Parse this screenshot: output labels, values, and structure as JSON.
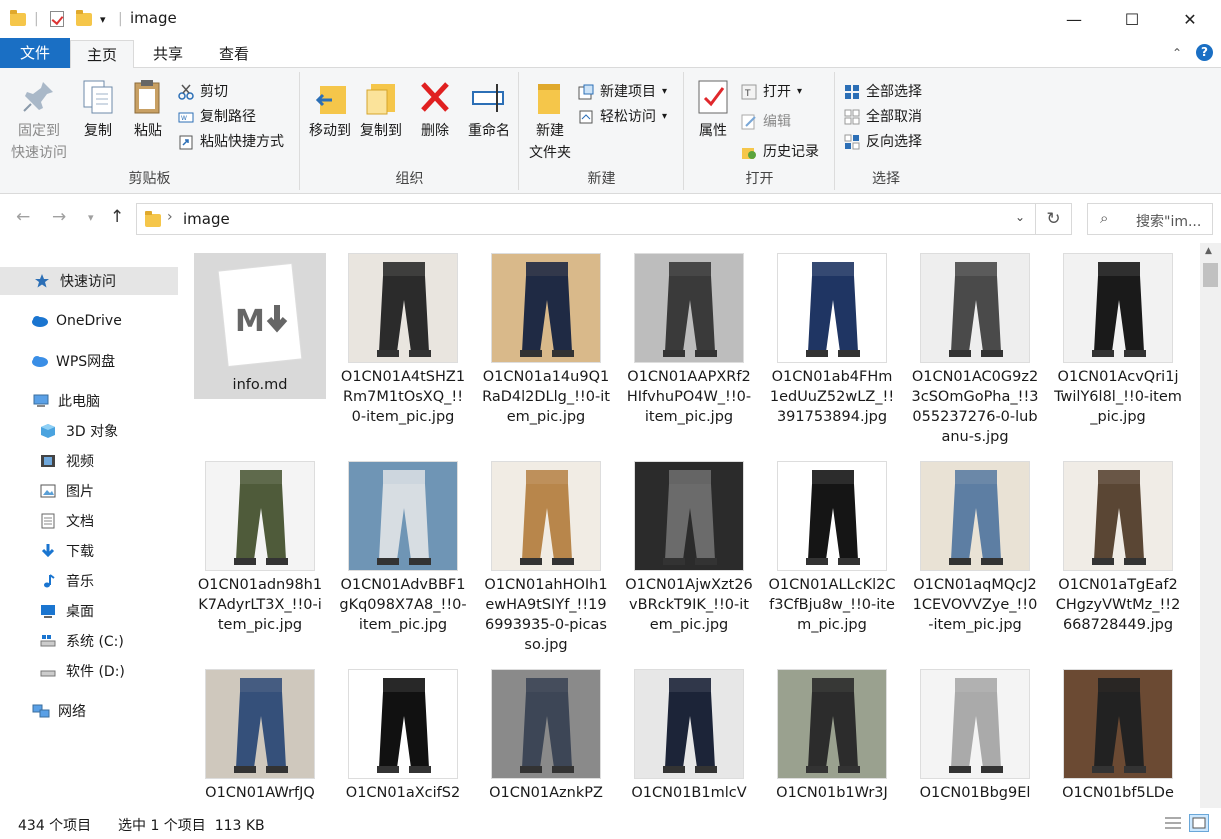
{
  "window": {
    "title": "image",
    "quick_access_dropdown": "▾",
    "minimize": "—",
    "maximize": "☐",
    "close": "✕"
  },
  "ribbon_tabs": {
    "file": "文件",
    "home": "主页",
    "share": "共享",
    "view": "查看"
  },
  "ribbon": {
    "clipboard": {
      "label": "剪贴板",
      "pin": "固定到\n快速访问",
      "pin_l1": "固定到",
      "pin_l2": "快速访问",
      "copy": "复制",
      "paste": "粘贴",
      "cut": "剪切",
      "copy_path": "复制路径",
      "paste_shortcut": "粘贴快捷方式"
    },
    "organize": {
      "label": "组织",
      "move_to": "移动到",
      "copy_to": "复制到",
      "delete": "删除",
      "rename": "重命名"
    },
    "new": {
      "label": "新建",
      "new_folder_l1": "新建",
      "new_folder_l2": "文件夹",
      "new_item": "新建项目",
      "easy_access": "轻松访问"
    },
    "open": {
      "label": "打开",
      "properties": "属性",
      "open": "打开",
      "edit": "编辑",
      "history": "历史记录"
    },
    "select": {
      "label": "选择",
      "select_all": "全部选择",
      "select_none": "全部取消",
      "invert": "反向选择"
    }
  },
  "address": {
    "path": "image",
    "search_placeholder": "搜索\"im..."
  },
  "sidebar": {
    "items": [
      {
        "label": "快速访问",
        "icon": "star-icon"
      },
      {
        "label": "OneDrive",
        "icon": "cloud-icon"
      },
      {
        "label": "WPS网盘",
        "icon": "cloud-icon"
      },
      {
        "label": "此电脑",
        "icon": "computer-icon"
      },
      {
        "label": "3D 对象",
        "icon": "cube-icon"
      },
      {
        "label": "视频",
        "icon": "film-icon"
      },
      {
        "label": "图片",
        "icon": "picture-icon"
      },
      {
        "label": "文档",
        "icon": "document-icon"
      },
      {
        "label": "下载",
        "icon": "download-icon"
      },
      {
        "label": "音乐",
        "icon": "music-icon"
      },
      {
        "label": "桌面",
        "icon": "desktop-icon"
      },
      {
        "label": "系统 (C:)",
        "icon": "drive-icon"
      },
      {
        "label": "软件 (D:)",
        "icon": "drive-icon"
      },
      {
        "label": "网络",
        "icon": "network-icon"
      }
    ]
  },
  "files": [
    {
      "name": "info.md",
      "kind": "markdown"
    },
    {
      "name": "O1CN01A4tSHZ1Rm7M1tOsXQ_!!0-item_pic.jpg",
      "tone": "#2b2b2b",
      "bg": "#e9e5df"
    },
    {
      "name": "O1CN01a14u9Q1RaD4l2DLlg_!!0-item_pic.jpg",
      "tone": "#1f2a44",
      "bg": "#d9b98a"
    },
    {
      "name": "O1CN01AAPXRf2HIfvhuPO4W_!!0-item_pic.jpg",
      "tone": "#3a3a3a",
      "bg": "#bdbdbd"
    },
    {
      "name": "O1CN01ab4FHm1edUuZ52wLZ_!!391753894.jpg",
      "tone": "#1f3563",
      "bg": "#ffffff"
    },
    {
      "name": "O1CN01AC0G9z23cSOmGoPha_!!3055237276-0-lubanu-s.jpg",
      "tone": "#4a4a4a",
      "bg": "#eeeeee"
    },
    {
      "name": "O1CN01AcvQri1jTwilY6l8l_!!0-item_pic.jpg",
      "tone": "#1a1a1a",
      "bg": "#f2f2f2"
    },
    {
      "name": "O1CN01adn98h1K7AdyrLT3X_!!0-item_pic.jpg",
      "tone": "#4f5b3a",
      "bg": "#f4f4f4"
    },
    {
      "name": "O1CN01AdvBBF1gKq098X7A8_!!0-item_pic.jpg",
      "tone": "#d7dde2",
      "bg": "#6f95b5"
    },
    {
      "name": "O1CN01ahHOIh1ewHA9tSIYf_!!196993935-0-picasso.jpg",
      "tone": "#b8864b",
      "bg": "#f1ece4"
    },
    {
      "name": "O1CN01AjwXzt26vBRckT9IK_!!0-item_pic.jpg",
      "tone": "#6b6b6b",
      "bg": "#2b2b2b"
    },
    {
      "name": "O1CN01ALLcKl2Cf3CfBju8w_!!0-item_pic.jpg",
      "tone": "#151515",
      "bg": "#ffffff"
    },
    {
      "name": "O1CN01aqMQcJ21CEVOVVZye_!!0-item_pic.jpg",
      "tone": "#5d7ea3",
      "bg": "#e9e2d5"
    },
    {
      "name": "O1CN01aTgEaf2CHgzyVWtMz_!!2668728449.jpg",
      "tone": "#5a4634",
      "bg": "#f0ece6"
    },
    {
      "name": "O1CN01AWrfJQ",
      "tone": "#35507a",
      "bg": "#cfc8bd"
    },
    {
      "name": "O1CN01aXcifS2",
      "tone": "#111111",
      "bg": "#ffffff"
    },
    {
      "name": "O1CN01AznkPZ",
      "tone": "#3d4656",
      "bg": "#8a8a8a"
    },
    {
      "name": "O1CN01B1mlcV",
      "tone": "#1c2438",
      "bg": "#e7e7e7"
    },
    {
      "name": "O1CN01b1Wr3J",
      "tone": "#2c2c2c",
      "bg": "#9aa18f"
    },
    {
      "name": "O1CN01Bbg9El",
      "tone": "#aaaaaa",
      "bg": "#f4f4f4"
    },
    {
      "name": "O1CN01bf5LDe",
      "tone": "#222222",
      "bg": "#6b4a33"
    }
  ],
  "status": {
    "count": "434 个项目",
    "selection": "选中 1 个项目  113 KB"
  }
}
